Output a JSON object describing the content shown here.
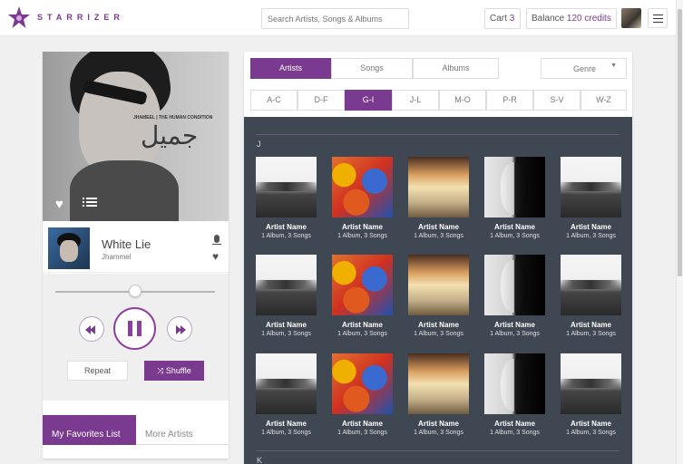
{
  "header": {
    "logo_text": "STARRIZER",
    "search_placeholder": "Search Artists, Songs & Albums",
    "cart_label": "Cart",
    "cart_count": "3",
    "balance_label": "Balance",
    "balance_value": "120 credits"
  },
  "player": {
    "cover_title": "JHAMEEL | THE HUMAN CONDITION",
    "cover_arabic": "جميل",
    "track_title": "White Lie",
    "track_artist": "Jhammel",
    "progress": 0.5,
    "repeat_label": "Repeat",
    "shuffle_label": "Shuffle",
    "tab_favorites": "My Favorites List",
    "tab_more": "More Artists"
  },
  "browser": {
    "view_tabs": [
      "Artists",
      "Songs",
      "Albums"
    ],
    "active_view": "Artists",
    "genre_label": "Genre",
    "alpha_tabs": [
      "A-C",
      "D-F",
      "G-I",
      "J-L",
      "M-O",
      "P-R",
      "S-V",
      "W-Z"
    ],
    "active_alpha": "G-I",
    "section_j": "J",
    "section_k": "K",
    "card_name": "Artist Name",
    "card_sub": "1 Album, 3 Songs"
  },
  "colors": {
    "accent": "#7a3a8f",
    "grid_bg": "#3f4752"
  }
}
